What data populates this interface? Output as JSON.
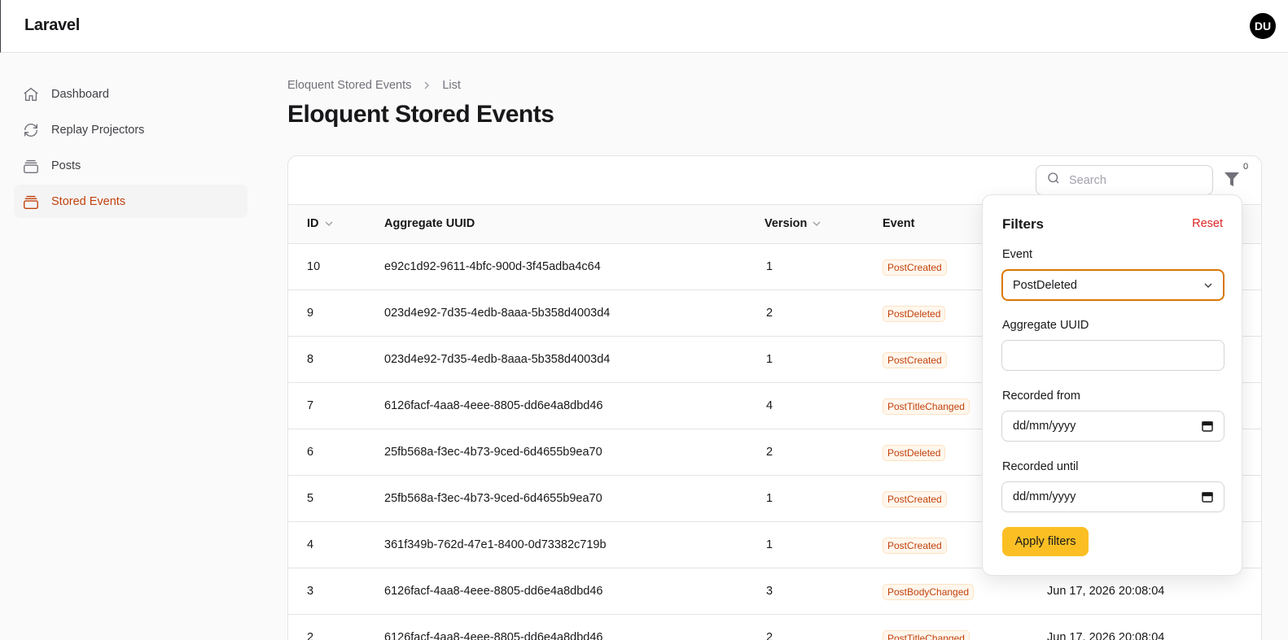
{
  "app": {
    "brand": "Laravel",
    "avatar_initials": "DU"
  },
  "sidebar": {
    "items": [
      {
        "label": "Dashboard",
        "icon": "home-icon"
      },
      {
        "label": "Replay Projectors",
        "icon": "refresh-icon"
      },
      {
        "label": "Posts",
        "icon": "stack-icon"
      },
      {
        "label": "Stored Events",
        "icon": "stack-icon",
        "active": true
      }
    ]
  },
  "breadcrumb": {
    "parent": "Eloquent Stored Events",
    "current": "List"
  },
  "page": {
    "title": "Eloquent Stored Events"
  },
  "toolbar": {
    "search_placeholder": "Search",
    "filter_count": "0"
  },
  "table": {
    "columns": [
      "ID",
      "Aggregate UUID",
      "Version",
      "Event"
    ],
    "rows": [
      {
        "id": "10",
        "uuid": "e92c1d92-9611-4bfc-900d-3f45adba4c64",
        "version": "1",
        "event": "PostCreated",
        "recorded": ""
      },
      {
        "id": "9",
        "uuid": "023d4e92-7d35-4edb-8aaa-5b358d4003d4",
        "version": "2",
        "event": "PostDeleted",
        "recorded": ""
      },
      {
        "id": "8",
        "uuid": "023d4e92-7d35-4edb-8aaa-5b358d4003d4",
        "version": "1",
        "event": "PostCreated",
        "recorded": ""
      },
      {
        "id": "7",
        "uuid": "6126facf-4aa8-4eee-8805-dd6e4a8dbd46",
        "version": "4",
        "event": "PostTitleChanged",
        "recorded": ""
      },
      {
        "id": "6",
        "uuid": "25fb568a-f3ec-4b73-9ced-6d4655b9ea70",
        "version": "2",
        "event": "PostDeleted",
        "recorded": ""
      },
      {
        "id": "5",
        "uuid": "25fb568a-f3ec-4b73-9ced-6d4655b9ea70",
        "version": "1",
        "event": "PostCreated",
        "recorded": ""
      },
      {
        "id": "4",
        "uuid": "361f349b-762d-47e1-8400-0d73382c719b",
        "version": "1",
        "event": "PostCreated",
        "recorded": ""
      },
      {
        "id": "3",
        "uuid": "6126facf-4aa8-4eee-8805-dd6e4a8dbd46",
        "version": "3",
        "event": "PostBodyChanged",
        "recorded": "Jun 17, 2026 20:08:04"
      },
      {
        "id": "2",
        "uuid": "6126facf-4aa8-4eee-8805-dd6e4a8dbd46",
        "version": "2",
        "event": "PostTitleChanged",
        "recorded": "Jun 17, 2026 20:08:04"
      }
    ]
  },
  "filters": {
    "title": "Filters",
    "reset_label": "Reset",
    "event_label": "Event",
    "event_value": "PostDeleted",
    "uuid_label": "Aggregate UUID",
    "uuid_value": "",
    "from_label": "Recorded from",
    "from_placeholder": "dd/mm/yyyy",
    "until_label": "Recorded until",
    "until_placeholder": "dd/mm/yyyy",
    "apply_label": "Apply filters"
  },
  "colors": {
    "accent": "#c2410c",
    "apply_button": "#fbbf24",
    "reset": "#dc2626",
    "focus_border": "#d97706"
  }
}
